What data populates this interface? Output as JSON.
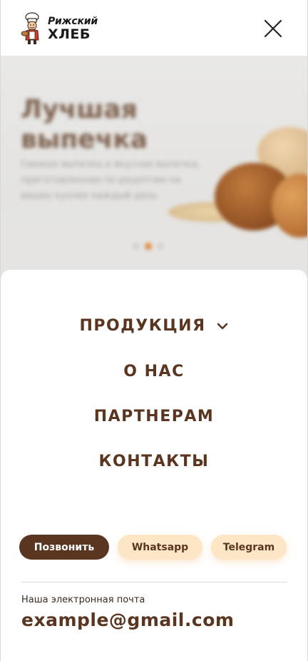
{
  "header": {
    "logo_line1": "Рижский",
    "logo_line2": "ХЛЕБ",
    "close_icon": "close-icon"
  },
  "hero": {
    "title": "Лучшая выпечка",
    "description": "Свежая выпечка и вкусная выпечка, приготовленная по рецептам на ваших кухнях каждый день",
    "slides_total": 3,
    "active_slide": 2
  },
  "nav": {
    "items": [
      {
        "label": "ПРОДУКЦИЯ",
        "has_dropdown": true,
        "icon": "chevron-down-icon"
      },
      {
        "label": "О НАС"
      },
      {
        "label": "ПАРТНЕРАМ"
      },
      {
        "label": "КОНТАКТЫ"
      }
    ]
  },
  "actions": {
    "call_label": "Позвонить",
    "whatsapp_label": "Whatsapp",
    "telegram_label": "Telegram"
  },
  "contact": {
    "email_label": "Наша электронная почта",
    "email": "example@gmail.com"
  },
  "colors": {
    "brand_brown": "#5a3520",
    "pill_light": "#fde6c6",
    "accent_orange": "#e08a3a"
  }
}
